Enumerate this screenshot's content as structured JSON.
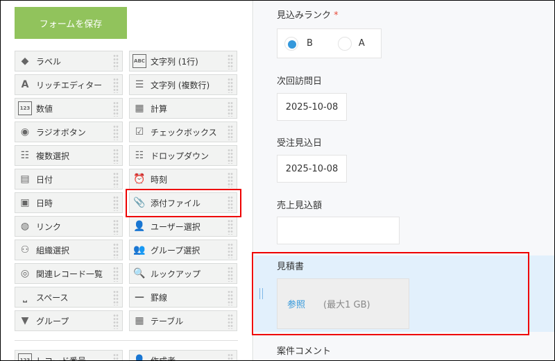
{
  "save_button": "フォームを保存",
  "palette": [
    {
      "label": "ラベル",
      "icon": "tag-icon",
      "glyph": "◆"
    },
    {
      "label": "文字列 (1行)",
      "icon": "abc-icon",
      "glyph": "ABC"
    },
    {
      "label": "リッチエディター",
      "icon": "rich-editor-icon",
      "glyph": "A"
    },
    {
      "label": "文字列 (複数行)",
      "icon": "multiline-text-icon",
      "glyph": "☰"
    },
    {
      "label": "数値",
      "icon": "number-icon",
      "glyph": "123"
    },
    {
      "label": "計算",
      "icon": "calculator-icon",
      "glyph": "▦"
    },
    {
      "label": "ラジオボタン",
      "icon": "radio-icon",
      "glyph": "◉"
    },
    {
      "label": "チェックボックス",
      "icon": "checkbox-icon",
      "glyph": "☑"
    },
    {
      "label": "複数選択",
      "icon": "multi-select-icon",
      "glyph": "☷"
    },
    {
      "label": "ドロップダウン",
      "icon": "dropdown-icon",
      "glyph": "☷"
    },
    {
      "label": "日付",
      "icon": "calendar-icon",
      "glyph": "▤"
    },
    {
      "label": "時刻",
      "icon": "clock-icon",
      "glyph": "⏰"
    },
    {
      "label": "日時",
      "icon": "datetime-icon",
      "glyph": "▣"
    },
    {
      "label": "添付ファイル",
      "icon": "paperclip-icon",
      "glyph": "📎"
    },
    {
      "label": "リンク",
      "icon": "globe-icon",
      "glyph": "◍"
    },
    {
      "label": "ユーザー選択",
      "icon": "user-icon",
      "glyph": "👤"
    },
    {
      "label": "組織選択",
      "icon": "org-icon",
      "glyph": "⚇"
    },
    {
      "label": "グループ選択",
      "icon": "group-icon",
      "glyph": "👥"
    },
    {
      "label": "関連レコード一覧",
      "icon": "related-records-icon",
      "glyph": "◎"
    },
    {
      "label": "ルックアップ",
      "icon": "lookup-icon",
      "glyph": "🔍"
    },
    {
      "label": "スペース",
      "icon": "space-icon",
      "glyph": "⎵"
    },
    {
      "label": "罫線",
      "icon": "line-icon",
      "glyph": "—"
    },
    {
      "label": "グループ",
      "icon": "group-field-icon",
      "glyph": "▼"
    },
    {
      "label": "テーブル",
      "icon": "table-icon",
      "glyph": "▦"
    },
    {
      "label": "レコード番号",
      "icon": "record-number-icon",
      "glyph": "123"
    },
    {
      "label": "作成者",
      "icon": "creator-icon",
      "glyph": "👤"
    }
  ],
  "form": {
    "rank_label": "見込みランク",
    "required": "*",
    "rank_options": [
      {
        "label": "B",
        "selected": true
      },
      {
        "label": "A",
        "selected": false
      }
    ],
    "visit_label": "次回訪問日",
    "visit_value": "2025-10-08",
    "order_label": "受注見込日",
    "order_value": "2025-10-08",
    "sales_label": "売上見込額",
    "sales_value": "",
    "estimate_label": "見積書",
    "browse": "参照",
    "max_size": "(最大1 GB)",
    "comment_label": "案件コメント"
  },
  "colors": {
    "accent": "#3498db",
    "save": "#91c35c",
    "highlight": "#e2f0fc",
    "annotation": "#ee0000"
  }
}
